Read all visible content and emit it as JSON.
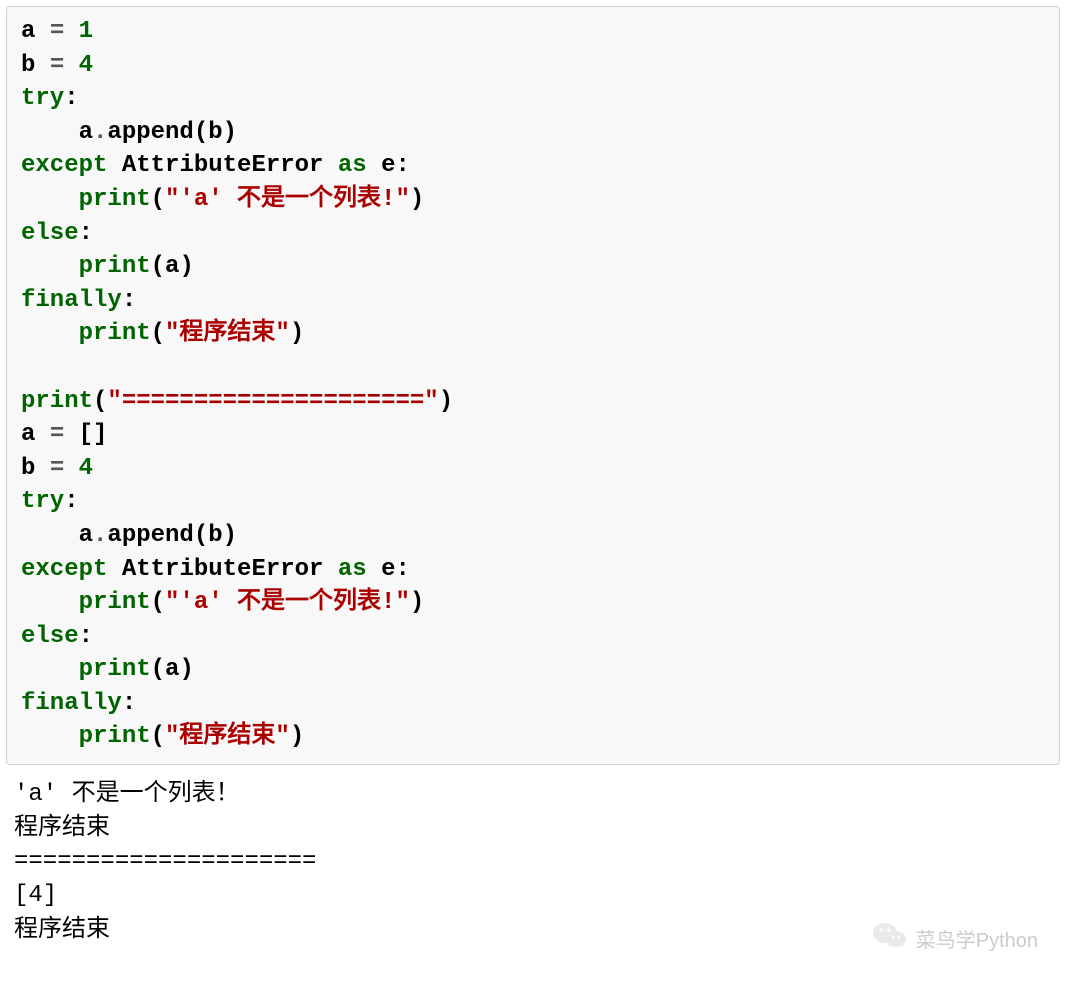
{
  "code": {
    "line1_a": "a ",
    "line1_eq": "= ",
    "line1_val": "1",
    "line2_a": "b ",
    "line2_eq": "= ",
    "line2_val": "4",
    "try_kw": "try",
    "colon": ":",
    "indent": "    ",
    "append_call_a": "a",
    "append_dot": ".",
    "append_name": "append",
    "append_open": "(",
    "append_arg": "b",
    "append_close": ")",
    "except_kw": "except",
    "space": " ",
    "exc_type": "AttributeError",
    "as_kw": "as",
    "exc_var": "e",
    "print_name": "print",
    "open": "(",
    "close": ")",
    "str_not_list": "\"'a' 不是一个列表!\"",
    "else_kw": "else",
    "arg_a": "a",
    "finally_kw": "finally",
    "str_end": "\"程序结束\"",
    "blank": "",
    "str_sep": "\"=====================\"",
    "line_a_list": "a ",
    "eq2": "= ",
    "empty_list": "[]",
    "line_b2": "b ",
    "b2_val": "4"
  },
  "output": {
    "line1": "'a' 不是一个列表！",
    "line2": "程序结束",
    "line3": "=====================",
    "line4": "[4]",
    "line5": "程序结束"
  },
  "watermark": {
    "text": "菜鸟学Python"
  }
}
